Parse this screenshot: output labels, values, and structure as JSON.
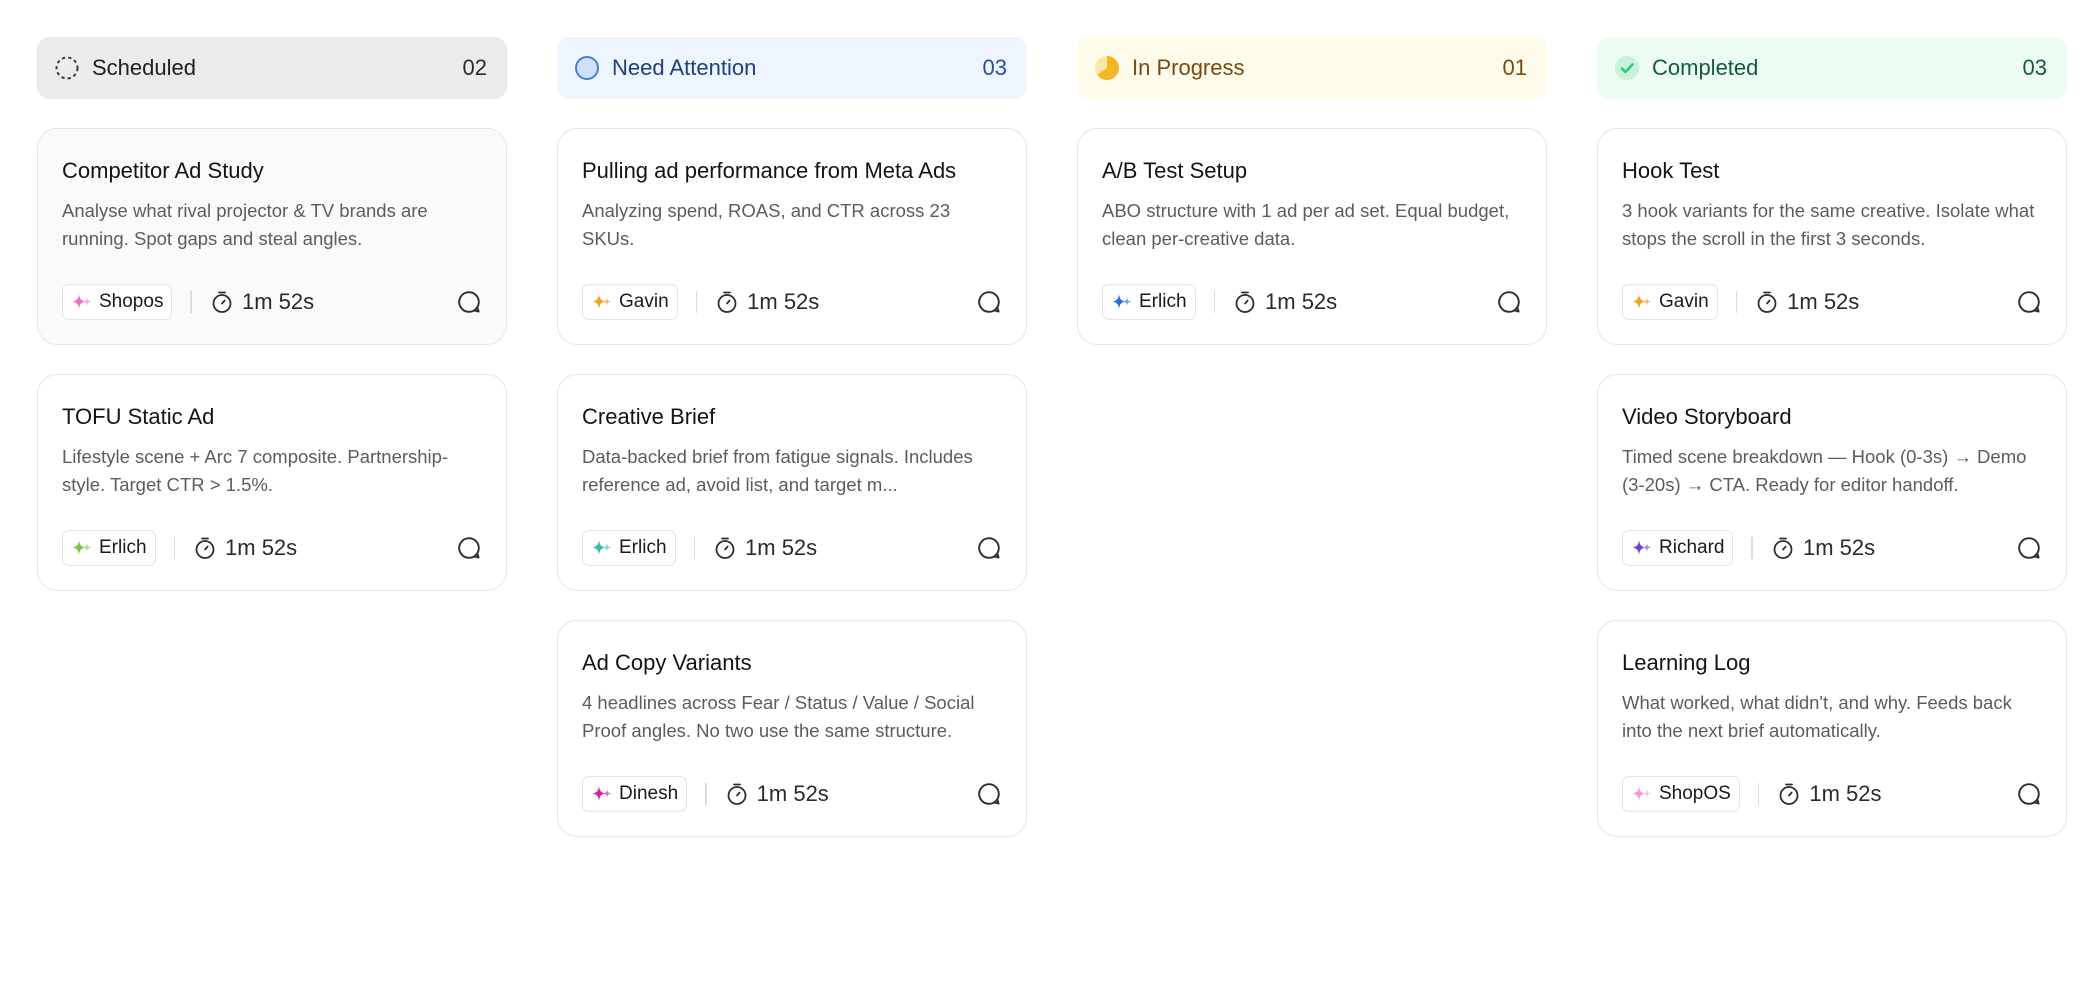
{
  "columns": [
    {
      "title": "Scheduled",
      "count": "02",
      "icon": "dashed-circle-icon",
      "colors": {
        "bg": "#ebebeb",
        "text": "#1f1f1f",
        "count": "#2b2b2b",
        "icon": "#3a3a3a"
      },
      "cards": [
        {
          "title": "Competitor Ad Study",
          "desc": "Analyse what rival projector & TV brands are running. Spot gaps and steal angles.",
          "agent": "Shopos",
          "agent_color": "#f06bd0",
          "agent_color2": "#f7b0ea",
          "time": "1m 52s",
          "muted": true
        },
        {
          "title": "TOFU Static Ad",
          "desc": "Lifestyle scene + Arc 7 composite. Partnership-style. Target CTR > 1.5%.",
          "agent": "Erlich",
          "agent_color": "#7fc241",
          "agent_color2": "#b6e07f",
          "time": "1m 52s",
          "muted": false
        }
      ]
    },
    {
      "title": "Need Attention",
      "count": "03",
      "icon": "circle-outline-icon",
      "colors": {
        "bg": "#eef5ff",
        "text": "#1f3f7a",
        "count": "#2a4f93",
        "icon": "#4a7fd0"
      },
      "cards": [
        {
          "title": "Pulling ad performance from Meta Ads",
          "desc": "Analyzing spend, ROAS, and CTR across 23 SKUs.",
          "agent": "Gavin",
          "agent_color": "#f4a21d",
          "agent_color2": "#f7c56a",
          "time": "1m 52s",
          "muted": false
        },
        {
          "title": "Creative Brief",
          "desc": "Data-backed brief from fatigue signals. Includes reference ad, avoid list, and target m...",
          "agent": "Erlich",
          "agent_color": "#2bbf9e",
          "agent_color2": "#7fe0c8",
          "time": "1m 52s",
          "muted": false
        },
        {
          "title": "Ad Copy Variants",
          "desc": "4 headlines across Fear / Status / Value / Social Proof angles. No two use the same structure.",
          "agent": "Dinesh",
          "agent_color": "#d81fa8",
          "agent_color2": "#ee6cc9",
          "time": "1m 52s",
          "muted": false
        }
      ]
    },
    {
      "title": "In Progress",
      "count": "01",
      "icon": "pie-progress-icon",
      "colors": {
        "bg": "#fffbeb",
        "text": "#7a4a10",
        "count": "#7a4a10",
        "icon": "#f4b625"
      },
      "cards": [
        {
          "title": "A/B Test Setup",
          "desc": "ABO structure with 1 ad per ad set. Equal budget, clean per-creative data.",
          "agent": "Erlich",
          "agent_color": "#1f6fe0",
          "agent_color2": "#6aa6f0",
          "time": "1m 52s",
          "muted": false
        }
      ]
    },
    {
      "title": "Completed",
      "count": "03",
      "icon": "check-circle-icon",
      "colors": {
        "bg": "#edfcf3",
        "text": "#125c3a",
        "count": "#125c3a",
        "icon": "#34c77b"
      },
      "cards": [
        {
          "title": "Hook Test",
          "desc": "3 hook variants for the same creative. Isolate what stops the scroll in the first 3 seconds.",
          "agent": "Gavin",
          "agent_color": "#f4a21d",
          "agent_color2": "#f7c56a",
          "time": "1m 52s",
          "muted": false
        },
        {
          "title": "Video Storyboard",
          "desc": "Timed scene breakdown — Hook (0-3s) → Demo (3-20s) → CTA. Ready for editor handoff.",
          "agent": "Richard",
          "agent_color": "#7a3fd1",
          "agent_color2": "#b18cef",
          "time": "1m 52s",
          "muted": false
        },
        {
          "title": "Learning Log",
          "desc": "What worked, what didn't, and why. Feeds back into the next brief automatically.",
          "agent": "ShopOS",
          "agent_color": "#f39ad8",
          "agent_color2": "#f8c9ea",
          "time": "1m 52s",
          "muted": false
        }
      ]
    }
  ]
}
